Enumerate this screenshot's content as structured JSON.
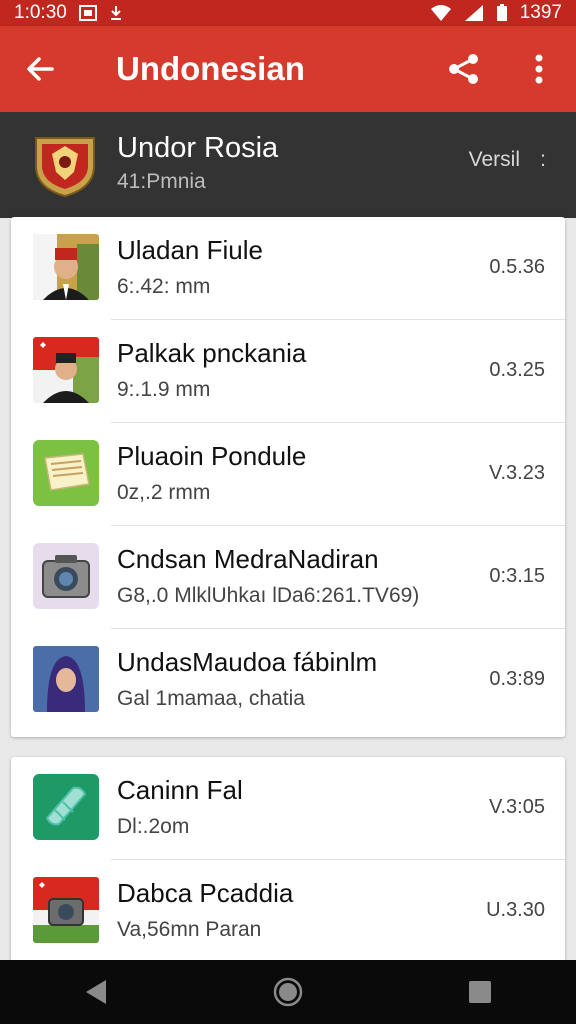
{
  "status_bar": {
    "time": "1:0:30",
    "right_text": "1397"
  },
  "app_bar": {
    "title": "Undonesian"
  },
  "header": {
    "title": "Undor Rosia",
    "subtitle": "41:Pmnia",
    "version_label": "Versil",
    "version_more": ":"
  },
  "list_primary": [
    {
      "name": "Uladan Fiule",
      "sub": "6:.42: mm",
      "ver": "0.5.36",
      "thumb": "portrait-red-hat"
    },
    {
      "name": "Palkak pnckania",
      "sub": "9:.1.9 mm",
      "ver": "0.3.25",
      "thumb": "portrait-flag"
    },
    {
      "name": "Pluaoin Pondule",
      "sub": "0z,.2 rmm",
      "ver": "V.3.23",
      "thumb": "notes-icon"
    },
    {
      "name": "Cndsan MedraNadiran",
      "sub": "G8,.0 MlklUhkaı lDa6:261.TV69)",
      "ver": "0:3.15",
      "thumb": "camera-icon"
    },
    {
      "name": "UndasMaudoa fábinlm",
      "sub": "Gal 1mamaa, chatia",
      "ver": "0.3:89",
      "thumb": "portrait-hijab"
    }
  ],
  "list_secondary": [
    {
      "name": "Caninn Fal",
      "sub": "Dl:.2om",
      "ver": "V.3:05",
      "thumb": "bandage-icon"
    },
    {
      "name": "Dabca Pcaddia",
      "sub": "Va,56mn Paran",
      "ver": "U.3.30",
      "thumb": "camera-flag-icon"
    }
  ],
  "colors": {
    "app_bar": "#d63a2c",
    "status_bar": "#c0281f",
    "header": "#333333",
    "background": "#e9e9e9"
  }
}
